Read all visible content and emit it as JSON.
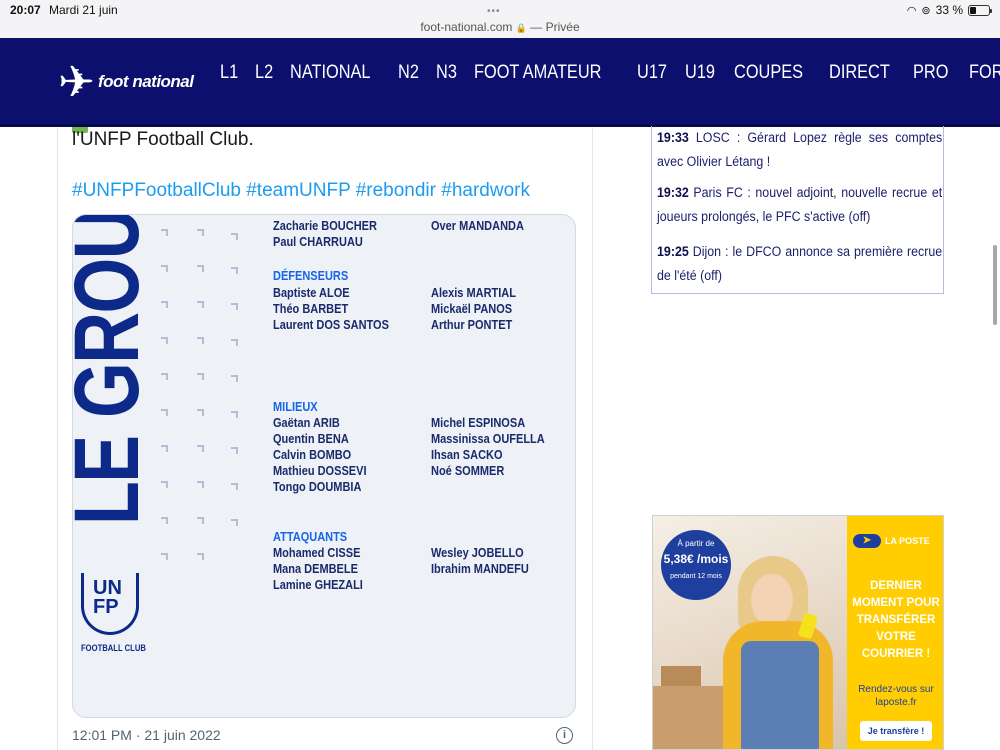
{
  "status_bar": {
    "time": "20:07",
    "date": "Mardi 21 juin",
    "url": "foot-national.com",
    "lock": "🔒",
    "private_label": "— Privée",
    "battery": "33 %"
  },
  "navbar": {
    "logo_text": "foot national",
    "items": [
      "L1",
      "L2",
      "NATIONAL",
      "N2",
      "N3",
      "FOOT AMATEUR",
      "U17",
      "U19",
      "COUPES",
      "DIRECT",
      "PRO",
      "FORUMS"
    ]
  },
  "tweet": {
    "text": "l'UNFP Football Club.",
    "hashtags": "#UNFPFootballClub #teamUNFP #rebondir #hardwork",
    "timestamp": "12:01 PM · 21 juin 2022",
    "info_icon": "i",
    "image": {
      "vertical_title": "LE GROUPE",
      "logo_text": "UN FP",
      "logo_caption": "FOOTBALL CLUB",
      "goalkeepers": {
        "left": [
          "Zacharie BOUCHER",
          "Paul CHARRUAU"
        ],
        "right": [
          "Over MANDANDA"
        ]
      },
      "defenders": {
        "heading": "DÉFENSEURS",
        "left": [
          "Baptiste ALOE",
          "Théo BARBET",
          "Laurent DOS SANTOS"
        ],
        "right": [
          "Alexis MARTIAL",
          "Mickaël PANOS",
          "Arthur PONTET"
        ]
      },
      "midfielders": {
        "heading": "MILIEUX",
        "left": [
          "Gaëtan ARIB",
          "Quentin BENA",
          "Calvin BOMBO",
          "Mathieu DOSSEVI",
          "Tongo DOUMBIA"
        ],
        "right": [
          "Michel ESPINOSA",
          "Massinissa OUFELLA",
          "Ihsan SACKO",
          "Noé SOMMER"
        ]
      },
      "forwards": {
        "heading": "ATTAQUANTS",
        "left": [
          "Mohamed CISSE",
          "Mana DEMBELE",
          "Lamine GHEZALI"
        ],
        "right": [
          "Wesley JOBELLO",
          "Ibrahim MANDEFU"
        ]
      }
    }
  },
  "live_feed": [
    {
      "time": "19:33",
      "text": "LOSC : Gérard Lopez règle ses comptes avec Olivier Létang !"
    },
    {
      "time": "19:32",
      "text": "Paris FC : nouvel adjoint, nouvelle recrue et joueurs prolongés, le PFC s'active (off)"
    },
    {
      "time": "19:25",
      "text": "Dijon : le DFCO annonce sa première recrue de l'été (off)"
    }
  ],
  "ad": {
    "badge_line1": "À partir de",
    "badge_line2": "5,38€ /mois",
    "badge_line3": "pendant 12 mois",
    "brand": "LA POSTE",
    "headline": "DERNIER MOMENT POUR TRANSFÉRER VOTRE COURRIER !",
    "sub": "Rendez-vous sur laposte.fr",
    "cta": "Je transfère !"
  },
  "colors": {
    "navbar_bg": "#0c0f6d",
    "hashtag_blue": "#1d9bf0",
    "roster_heading_blue": "#1565e8",
    "roster_text": "#1a2a6c",
    "ad_yellow": "#ffcd00"
  }
}
